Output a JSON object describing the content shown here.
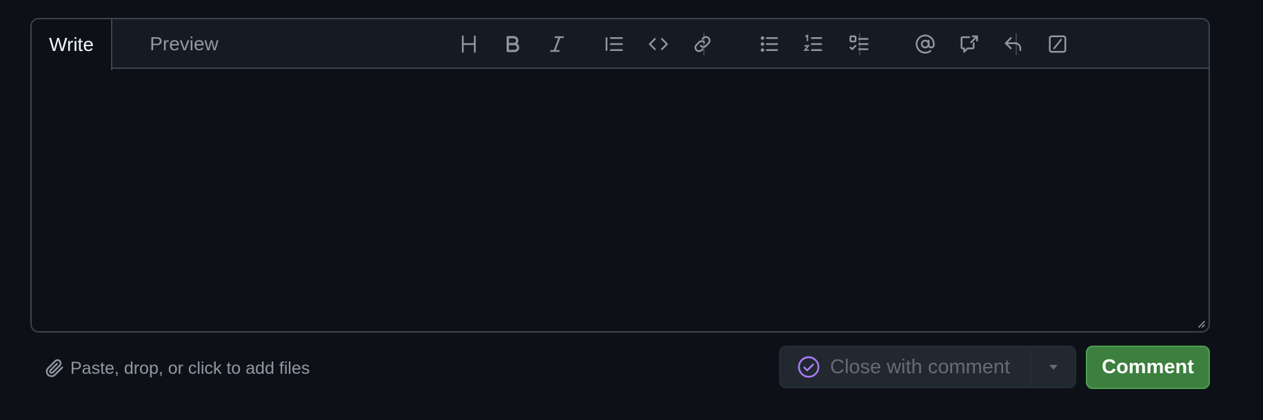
{
  "tabs": {
    "write": "Write",
    "preview": "Preview"
  },
  "toolbar": {
    "icons": [
      "heading-icon",
      "bold-icon",
      "italic-icon",
      "quote-icon",
      "code-icon",
      "link-icon",
      "unordered-list-icon",
      "ordered-list-icon",
      "task-list-icon",
      "mention-icon",
      "cross-reference-icon",
      "saved-reply-icon",
      "slash-command-icon"
    ]
  },
  "editor": {
    "value": "",
    "placeholder": ""
  },
  "footer": {
    "attach_label": "Paste, drop, or click to add files",
    "close_label": "Close with comment",
    "comment_label": "Comment"
  },
  "colors": {
    "background": "#0d1117",
    "header_bg": "#151b23",
    "border": "#3d444d",
    "comment_button": "#3c7f3e",
    "close_icon": "#ab7df8",
    "muted_text": "#9198a1"
  }
}
